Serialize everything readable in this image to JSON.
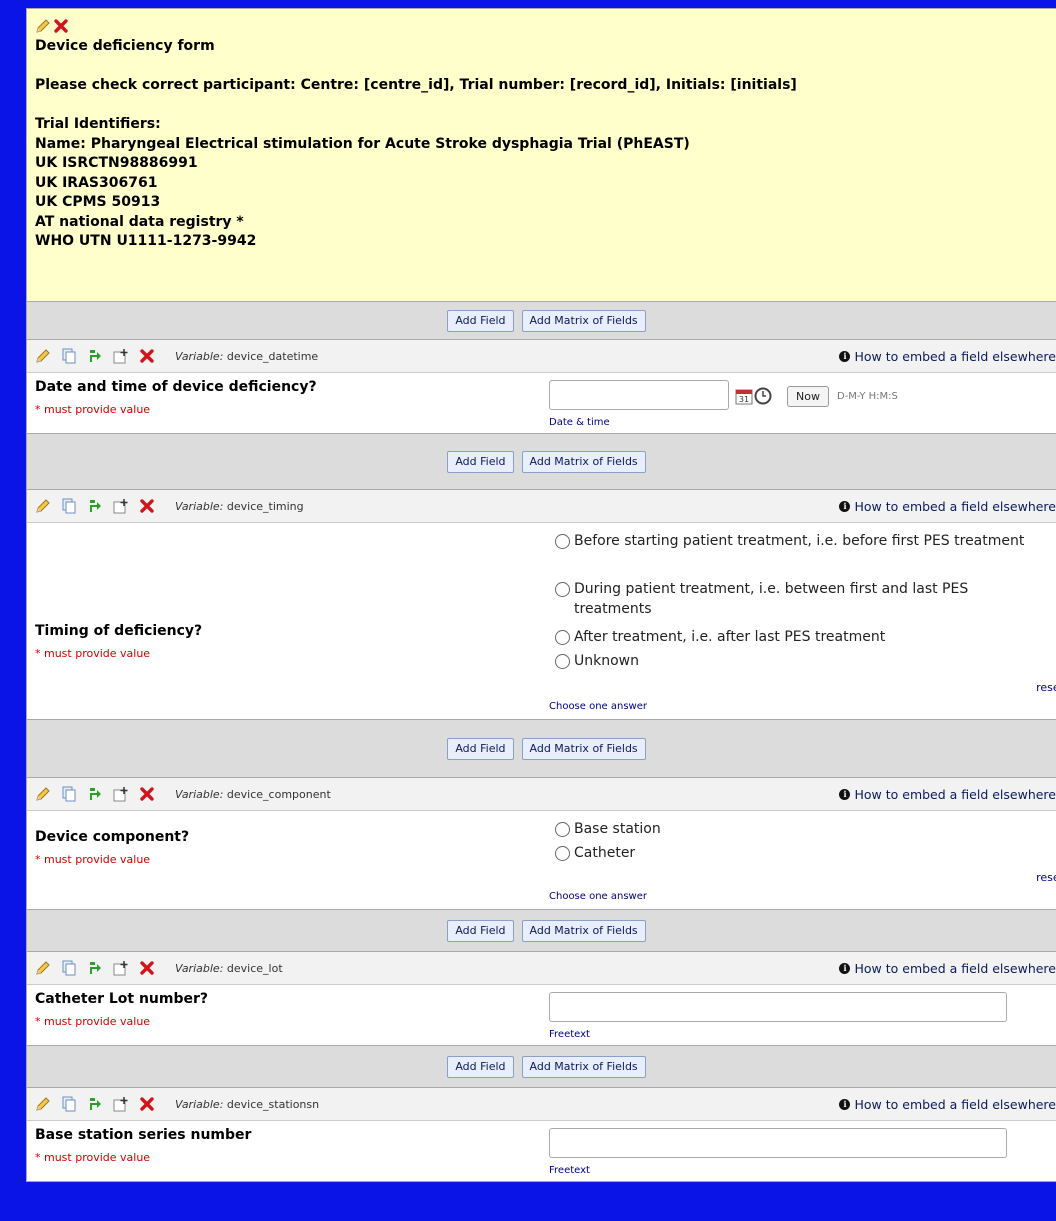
{
  "header": {
    "title": "Device deficiency form",
    "check": "Please check correct participant: Centre: [centre_id], Trial number: [record_id], Initials: [initials]",
    "identifiers_label": "Trial Identifiers:",
    "name": "Name: Pharyngeal Electrical stimulation for Acute Stroke dysphagia Trial (PhEAST)",
    "isrctn": "UK ISRCTN98886991",
    "iras": "UK IRAS306761",
    "cpms": "UK CPMS 50913",
    "at": "AT national data registry *",
    "who": "WHO UTN U1111-1273-9942"
  },
  "addbar": {
    "add_field": "Add Field",
    "add_matrix": "Add Matrix of Fields"
  },
  "common": {
    "variable_prefix": "Variable:",
    "embed": "How to embed a field elsewhere",
    "required": "* must provide value",
    "reset": "reset",
    "choose_one": "Choose one answer",
    "freetext": "Freetext"
  },
  "fields": [
    {
      "variable": "device_datetime",
      "label": "Date and time of device deficiency?",
      "note": "Date & time",
      "now": "Now",
      "format": "D-M-Y H:M:S"
    },
    {
      "variable": "device_timing",
      "label": "Timing of deficiency?",
      "options": [
        "Before starting patient treatment, i.e. before first PES treatment",
        "During patient treatment, i.e. between first and last PES treatments",
        "After treatment, i.e. after last PES treatment",
        "Unknown"
      ]
    },
    {
      "variable": "device_component",
      "label": "Device component?",
      "options": [
        "Base station",
        "Catheter"
      ]
    },
    {
      "variable": "device_lot",
      "label": "Catheter Lot number?"
    },
    {
      "variable": "device_stationsn",
      "label": "Base station series number"
    }
  ],
  "colors": {
    "background": "#0a14e6",
    "header_bg": "#ffffcc",
    "required": "#cc0000",
    "link": "#000080"
  }
}
